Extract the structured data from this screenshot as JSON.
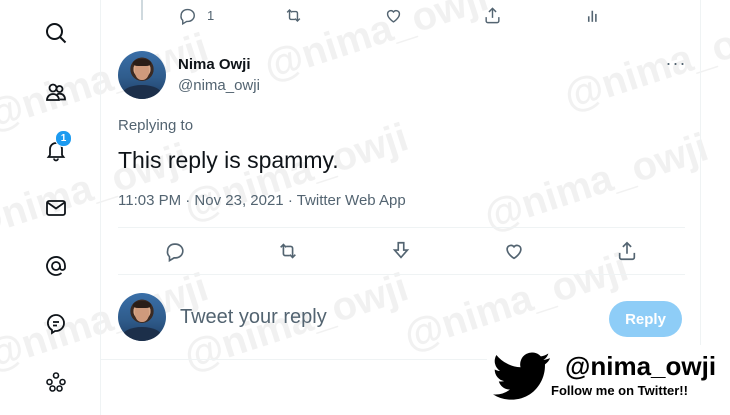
{
  "colors": {
    "accent": "#1d9bf0",
    "muted": "#536471",
    "reply_disabled": "#8ecdf7"
  },
  "sidebar": {
    "items": [
      {
        "icon": "search-icon"
      },
      {
        "icon": "communities-icon"
      },
      {
        "icon": "notifications-bell-icon",
        "badge": "1"
      },
      {
        "icon": "messages-envelope-icon"
      },
      {
        "icon": "mention-at-icon"
      },
      {
        "icon": "topics-icon"
      },
      {
        "icon": "more-circles-icon"
      }
    ]
  },
  "parent_tweet_actions": {
    "reply_count": "1"
  },
  "tweet": {
    "author_name": "Nima Owji",
    "author_handle": "@nima_owji",
    "replying_to_label": "Replying to",
    "text": "This reply is spammy.",
    "time": "11:03 PM · Nov 23, 2021 · ",
    "source_app": "Twitter Web App"
  },
  "composer": {
    "placeholder": "Tweet your reply",
    "reply_button": "Reply"
  },
  "watermark": {
    "text": "@nima_owji"
  },
  "promo": {
    "handle": "@nima_owji",
    "follow_text": "Follow me on Twitter!!"
  }
}
